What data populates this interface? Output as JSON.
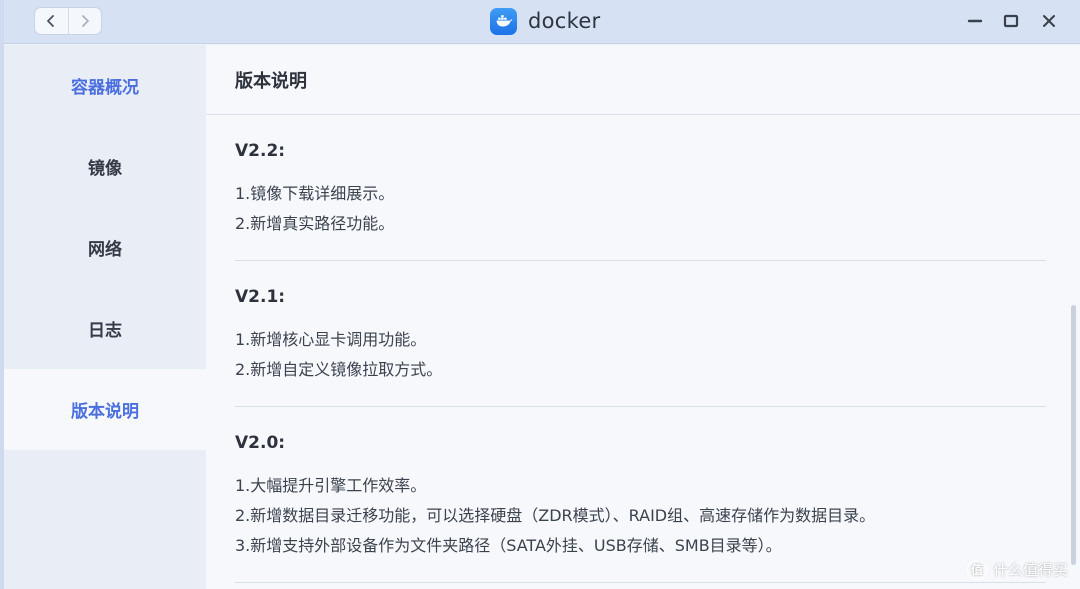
{
  "window": {
    "title": "docker",
    "accent_color": "#4b6fde",
    "icons": {
      "back": "chevron-left-icon",
      "forward": "chevron-right-icon",
      "app": "docker-whale-icon",
      "minimize": "minimize-icon",
      "maximize": "maximize-icon",
      "close": "close-icon"
    }
  },
  "sidebar": {
    "items": [
      {
        "label": "容器概况"
      },
      {
        "label": "镜像"
      },
      {
        "label": "网络"
      },
      {
        "label": "日志"
      },
      {
        "label": "版本说明"
      }
    ]
  },
  "content": {
    "title": "版本说明",
    "versions": [
      {
        "version": "V2.2:",
        "notes": [
          "1.镜像下载详细展示。",
          "2.新增真实路径功能。"
        ]
      },
      {
        "version": "V2.1:",
        "notes": [
          "1.新增核心显卡调用功能。",
          "2.新增自定义镜像拉取方式。"
        ]
      },
      {
        "version": "V2.0:",
        "notes": [
          "1.大幅提升引擎工作效率。",
          "2.新增数据目录迁移功能，可以选择硬盘（ZDR模式）、RAID组、高速存储作为数据目录。",
          "3.新增支持外部设备作为文件夹路径（SATA外挂、USB存储、SMB目录等）。"
        ]
      }
    ]
  },
  "watermark": {
    "badge": "值",
    "text": "什么值得买"
  }
}
